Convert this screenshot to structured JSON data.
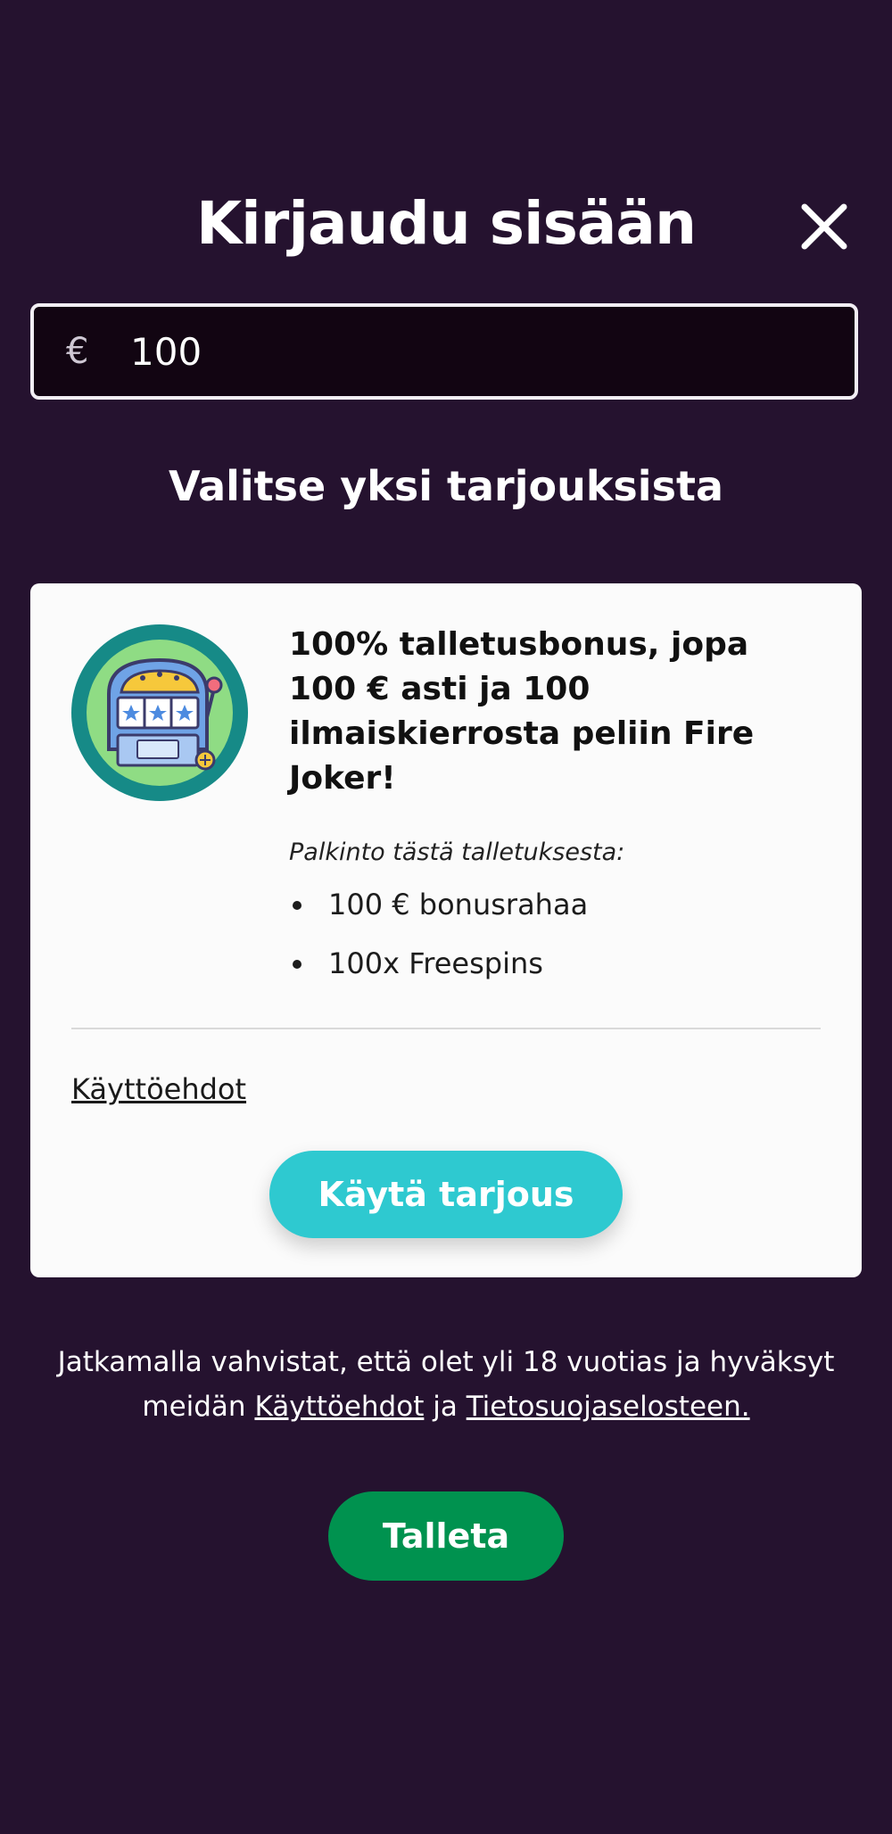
{
  "header": {
    "title": "Kirjaudu sisään",
    "close_icon": "close-icon"
  },
  "amount": {
    "currency_symbol": "€",
    "value": "100"
  },
  "offers_heading": "Valitse yksi tarjouksista",
  "offer": {
    "icon": "slot-machine-icon",
    "title": "100% talletusbonus, jopa 100 € asti ja 100 ilmaiskierrosta peliin Fire Joker!",
    "reward_label": "Palkinto tästä talletuksesta:",
    "rewards": [
      "100 € bonusrahaa",
      "100x Freespins"
    ],
    "terms_link": "Käyttöehdot",
    "button": "Käytä tarjous"
  },
  "disclaimer": {
    "text_before": "Jatkamalla vahvistat, että olet yli 18 vuotias ja hyväksyt meidän ",
    "terms_link": "Käyttöehdot",
    "middle": " ja ",
    "privacy_link": "Tietosuojaselosteen."
  },
  "deposit_button": "Talleta",
  "colors": {
    "background": "#25122f",
    "accent_button": "#2ec9d0",
    "deposit_button": "#00924f"
  }
}
